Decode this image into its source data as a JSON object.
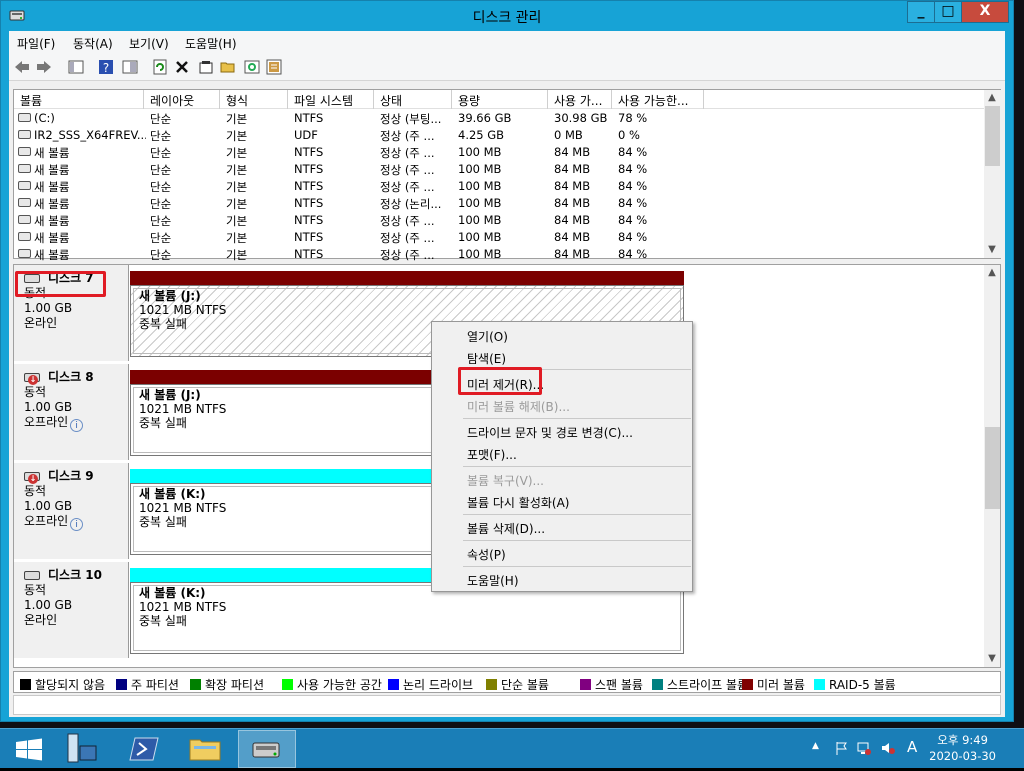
{
  "window": {
    "title": "디스크 관리"
  },
  "menu": [
    "파일(F)",
    "동작(A)",
    "보기(V)",
    "도움말(H)"
  ],
  "columns": [
    "볼륨",
    "레이아웃",
    "형식",
    "파일 시스템",
    "상태",
    "용량",
    "사용 가...",
    "사용 가능한..."
  ],
  "volumes": [
    {
      "name": "(C:)",
      "layout": "단순",
      "type": "기본",
      "fs": "NTFS",
      "status": "정상 (부팅...",
      "capacity": "39.66 GB",
      "free": "30.98 GB",
      "pct": "78 %"
    },
    {
      "name": "IR2_SSS_X64FREV...",
      "layout": "단순",
      "type": "기본",
      "fs": "UDF",
      "status": "정상 (주 ...",
      "capacity": "4.25 GB",
      "free": "0 MB",
      "pct": "0 %"
    },
    {
      "name": "새 볼륨",
      "layout": "단순",
      "type": "기본",
      "fs": "NTFS",
      "status": "정상 (주 ...",
      "capacity": "100 MB",
      "free": "84 MB",
      "pct": "84 %"
    },
    {
      "name": "새 볼륨",
      "layout": "단순",
      "type": "기본",
      "fs": "NTFS",
      "status": "정상 (주 ...",
      "capacity": "100 MB",
      "free": "84 MB",
      "pct": "84 %"
    },
    {
      "name": "새 볼륨",
      "layout": "단순",
      "type": "기본",
      "fs": "NTFS",
      "status": "정상 (주 ...",
      "capacity": "100 MB",
      "free": "84 MB",
      "pct": "84 %"
    },
    {
      "name": "새 볼륨",
      "layout": "단순",
      "type": "기본",
      "fs": "NTFS",
      "status": "정상 (논리...",
      "capacity": "100 MB",
      "free": "84 MB",
      "pct": "84 %"
    },
    {
      "name": "새 볼륨",
      "layout": "단순",
      "type": "기본",
      "fs": "NTFS",
      "status": "정상 (주 ...",
      "capacity": "100 MB",
      "free": "84 MB",
      "pct": "84 %"
    },
    {
      "name": "새 볼륨",
      "layout": "단순",
      "type": "기본",
      "fs": "NTFS",
      "status": "정상 (주 ...",
      "capacity": "100 MB",
      "free": "84 MB",
      "pct": "84 %"
    },
    {
      "name": "새 볼륨",
      "layout": "단순",
      "type": "기본",
      "fs": "NTFS",
      "status": "정상 (주 ...",
      "capacity": "100 MB",
      "free": "84 MB",
      "pct": "84 %"
    }
  ],
  "disks": [
    {
      "title": "디스크 7",
      "kind": "동적",
      "size": "1.00 GB",
      "state": "온라인",
      "bar_color": "#7b0000",
      "part_name": "새 볼륨  (J:)",
      "part_size": "1021 MB NTFS",
      "part_status": "중복 실패"
    },
    {
      "title": "디스크 8",
      "kind": "동적",
      "size": "1.00 GB",
      "state": "오프라인",
      "bar_color": "#7b0000",
      "part_name": "새 볼륨  (J:)",
      "part_size": "1021 MB NTFS",
      "part_status": "중복 실패"
    },
    {
      "title": "디스크 9",
      "kind": "동적",
      "size": "1.00 GB",
      "state": "오프라인",
      "bar_color": "#00ffff",
      "part_name": "새 볼륨  (K:)",
      "part_size": "1021 MB NTFS",
      "part_status": "중복 실패"
    },
    {
      "title": "디스크 10",
      "kind": "동적",
      "size": "1.00 GB",
      "state": "온라인",
      "bar_color": "#00ffff",
      "part_name": "새 볼륨  (K:)",
      "part_size": "1021 MB NTFS",
      "part_status": "중복 실패"
    }
  ],
  "legend": [
    {
      "label": "할당되지 않음",
      "color": "#000000"
    },
    {
      "label": "주 파티션",
      "color": "#000080"
    },
    {
      "label": "확장 파티션",
      "color": "#008000"
    },
    {
      "label": "사용 가능한 공간",
      "color": "#00ff00"
    },
    {
      "label": "논리 드라이브",
      "color": "#0000ff"
    },
    {
      "label": "단순 볼륨",
      "color": "#808000"
    },
    {
      "label": "스팬 볼륨",
      "color": "#800080"
    },
    {
      "label": "스트라이프 볼륨",
      "color": "#008080"
    },
    {
      "label": "미러 볼륨",
      "color": "#800000"
    },
    {
      "label": "RAID-5 볼륨",
      "color": "#00ffff"
    }
  ],
  "context_menu": {
    "open": "열기(O)",
    "explore": "탐색(E)",
    "remove_mirror": "미러 제거(R)...",
    "break_mirror": "미러 볼륨 해제(B)...",
    "change_letter": "드라이브 문자 및 경로 변경(C)...",
    "format": "포맷(F)...",
    "repair": "볼륨 복구(V)...",
    "reactivate": "볼륨 다시 활성화(A)",
    "delete": "볼륨 삭제(D)...",
    "properties": "속성(P)",
    "help": "도움말(H)"
  },
  "taskbar": {
    "time": "오후 9:49",
    "date": "2020-03-30",
    "ime": "A"
  }
}
